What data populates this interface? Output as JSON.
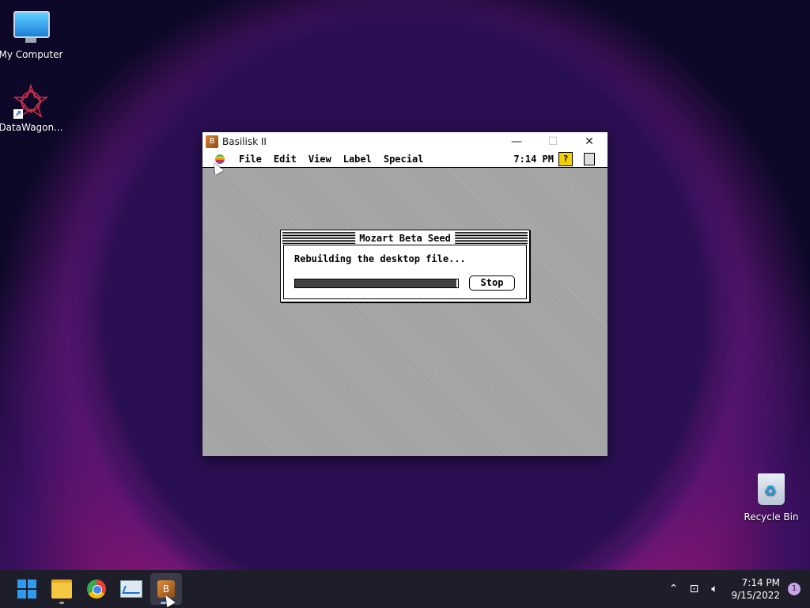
{
  "desktop": {
    "icons": [
      {
        "label": "My Computer",
        "icon": "monitor-icon"
      },
      {
        "label": "DataWagon...",
        "icon": "datawagon-star-icon"
      },
      {
        "label": "Recycle Bin",
        "icon": "recycle-bin-icon"
      }
    ]
  },
  "window": {
    "title": "Basilisk II",
    "controls": {
      "minimize": "—",
      "maximize": "☐",
      "close": "✕"
    }
  },
  "mac": {
    "menu": [
      "File",
      "Edit",
      "View",
      "Label",
      "Special"
    ],
    "clock": "7:14 PM",
    "help_icon": "?"
  },
  "dialog": {
    "title": "Mozart Beta Seed",
    "message": "Rebuilding the desktop file...",
    "progress": 0.99,
    "stop_label": "Stop"
  },
  "taskbar": {
    "time": "7:14 PM",
    "date": "9/15/2022",
    "notifications": "1",
    "tray_icons": [
      "chevron-up-icon",
      "network-icon",
      "volume-icon"
    ]
  }
}
